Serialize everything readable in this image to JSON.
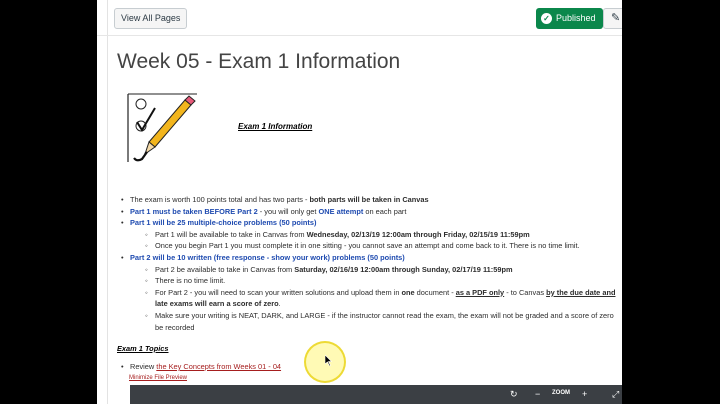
{
  "toolbar": {
    "view_all_label": "View All Pages",
    "published_label": "Published",
    "edit_icon": "pencil-icon"
  },
  "page": {
    "title": "Week 05 - Exam 1 Information",
    "info_heading": "Exam 1 Information"
  },
  "content": {
    "item1": {
      "text": "The exam is worth 100 points total and has two parts - ",
      "bold": "both parts will be taken in Canvas"
    },
    "item2": {
      "blue": "Part 1 must be taken BEFORE Part 2",
      "text": " - you will only get ",
      "blue2": "ONE attempt",
      "text2": " on each part"
    },
    "item3": {
      "blue": "Part 1 will be 25 multiple-choice problems (50 points)"
    },
    "item3_sub1": {
      "text": "Part 1 will be available to take in Canvas from ",
      "bold": "Wednesday, 02/13/19 12:00am through Friday, 02/15/19 11:59pm"
    },
    "item3_sub2": {
      "text": "Once you begin Part 1 you must complete it in one sitting - you cannot save an attempt and come back to it. There is no time limit."
    },
    "item4": {
      "blue": "Part 2 will be 10 written (free response - show your work) problems (50 points)"
    },
    "item4_sub1": {
      "text": "Part 2 be available to take in Canvas from ",
      "bold": "Saturday, 02/16/19 12:00am through Sunday, 02/17/19 11:59pm"
    },
    "item4_sub2": {
      "text": "There is no time limit."
    },
    "item4_sub3": {
      "text": "For Part 2 - you will need to scan your written solutions and upload them in ",
      "bold": "one",
      "text2": " document - ",
      "bold2": "as a PDF only",
      "text3": " - to Canvas ",
      "bold3": "by the due date and",
      "line2": "late exams will earn a score of zero",
      "text4": "."
    },
    "item4_sub4": {
      "text": "Make sure your writing is NEAT, DARK, and LARGE - if the instructor cannot read the exam, the exam will not be graded and a score of zero",
      "line2": "be recorded"
    }
  },
  "topics": {
    "heading": "Exam 1 Topics",
    "review_prefix": "Review ",
    "review_link": "the Key Concepts from Weeks 01 - 04",
    "minimize_label": "Minimize File Preview"
  },
  "preview_toolbar": {
    "zoom_label": "ZOOM",
    "icons": [
      "rotate-icon",
      "zoom-out-icon",
      "zoom-in-icon",
      "fullscreen-icon"
    ]
  }
}
